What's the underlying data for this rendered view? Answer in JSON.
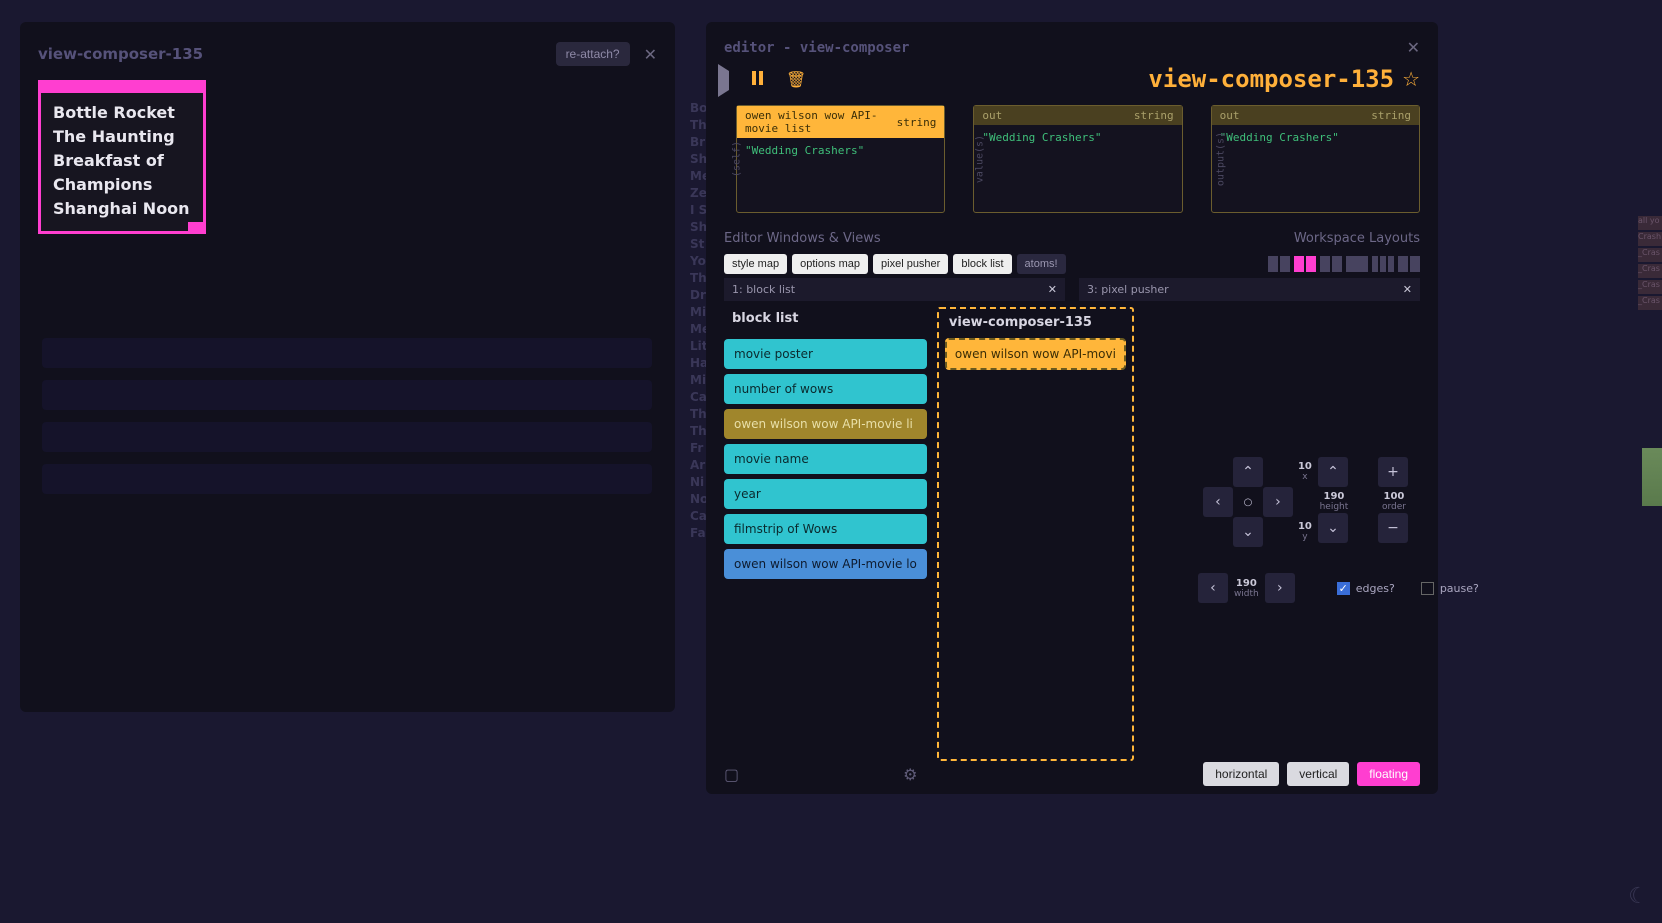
{
  "left": {
    "title": "view-composer-135",
    "reattach": "re-attach?",
    "movies": [
      "Bottle Rocket",
      "The Haunting",
      "Breakfast of Champions",
      "Shanghai Noon"
    ]
  },
  "bg_movies": [
    "Bo",
    "Th",
    "Br",
    "Sh",
    "Me",
    "Ze",
    "I S",
    "Sh",
    "St",
    "Yo",
    "Th",
    "Dr",
    "Mi",
    "Me",
    "Lit",
    "Ha",
    "Mi",
    "Ca",
    "Th",
    "Th",
    "Fr",
    "Ar",
    "Ni",
    "No",
    "Ca",
    "Fa"
  ],
  "editor": {
    "header": "editor - view-composer",
    "big_title": "view-composer-135",
    "cards": [
      {
        "title": "owen wilson wow API-movie list",
        "type": "string",
        "value": "\"Wedding Crashers\"",
        "side": "(self)",
        "active": true
      },
      {
        "title": "out",
        "type": "string",
        "value": "\"Wedding Crashers\"",
        "side": "value(s)",
        "active": false
      },
      {
        "title": "out",
        "type": "string",
        "value": "\"Wedding Crashers\"",
        "side": "output(s)",
        "active": false
      }
    ],
    "section_windows": "Editor Windows & Views",
    "section_layouts": "Workspace Layouts",
    "chips": [
      "style map",
      "options map",
      "pixel pusher",
      "block list",
      "atoms!"
    ],
    "tabs": [
      {
        "label": "1: block list"
      },
      {
        "label": "3: pixel pusher"
      }
    ],
    "block_list": {
      "title": "block list",
      "items": [
        {
          "label": "movie poster",
          "kind": "teal"
        },
        {
          "label": "number of wows",
          "kind": "teal"
        },
        {
          "label": "owen wilson wow API-movie li",
          "kind": "yellow"
        },
        {
          "label": "movie name",
          "kind": "teal"
        },
        {
          "label": "year",
          "kind": "teal"
        },
        {
          "label": "filmstrip of Wows",
          "kind": "teal"
        },
        {
          "label": "owen wilson wow API-movie lo",
          "kind": "blue"
        }
      ],
      "drop_title": "view-composer-135",
      "drop_chip": "owen wilson wow API-movi"
    },
    "px": {
      "x": "10",
      "y": "10",
      "height": "190",
      "order": "100",
      "width": "190",
      "edges": "edges?",
      "pause": "pause?"
    },
    "footer": {
      "horizontal": "horizontal",
      "vertical": "vertical",
      "floating": "floating"
    }
  },
  "right_stubs": [
    "all yo",
    "Crash",
    "_Cras",
    "_Cras",
    "_Cras",
    "_Cras"
  ]
}
